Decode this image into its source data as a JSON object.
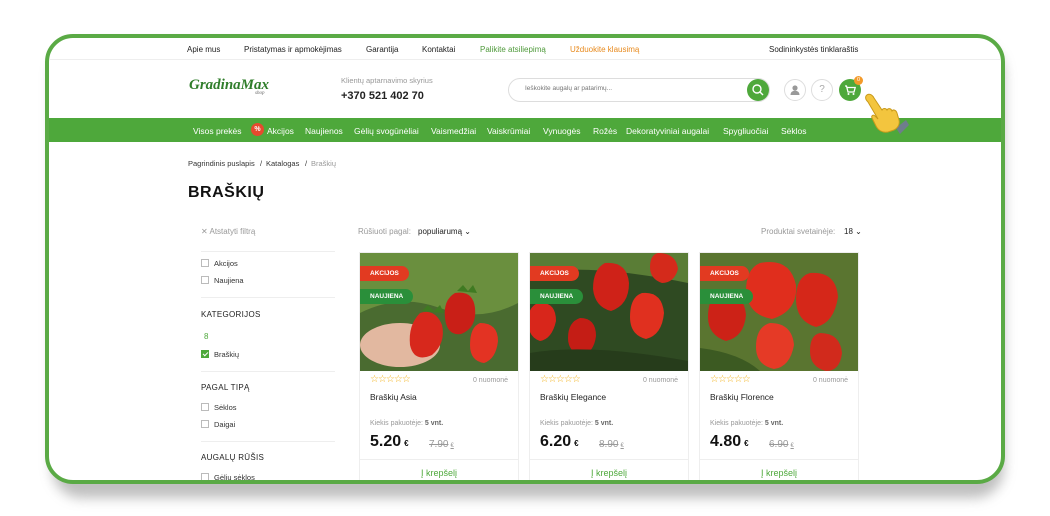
{
  "topbar": {
    "links": [
      "Apie mus",
      "Pristatymas ir apmokėjimas",
      "Garantija",
      "Kontaktai",
      "Palikite atsiliepimą",
      "Užduokite klausimą"
    ],
    "right_link": "Sodininkystės tinklaraštis"
  },
  "header": {
    "logo": "GradinaMax",
    "logo_sub": "shop",
    "cs_label": "Klientų aptarnavimo skyrius",
    "phone": "+370 521 402 70",
    "search_placeholder": "Ieškokite augalų ar patarimų...",
    "cart_count": "0"
  },
  "nav": {
    "items": [
      "Visos prekės",
      "Akcijos",
      "Naujienos",
      "Gėlių svogūnėliai",
      "Vaismedžiai",
      "Vaiskrūmiai",
      "Vynuogės",
      "Rožės",
      "Dekoratyviniai augalai",
      "Spygliuočiai",
      "Sėklos"
    ],
    "promo_symbol": "%"
  },
  "breadcrumb": [
    "Pagrindinis puslapis",
    "Katalogas",
    "Braškių"
  ],
  "page_title": "BRAŠKIŲ",
  "sidebar": {
    "reset": "Atstatyti filtrą",
    "flags": [
      "Akcijos",
      "Naujiena"
    ],
    "categories_title": "KATEGORIJOS",
    "category_count": "8",
    "category_checked": "Braškių",
    "type_title": "PAGAL TIPĄ",
    "types": [
      "Sėklos",
      "Daigai"
    ],
    "plant_title": "AUGALŲ RŪŠIS",
    "plants": [
      "Gėlių sėklos"
    ]
  },
  "toolbar": {
    "sort_label": "Rūšiuoti pagal:",
    "sort_value": "populiarumą",
    "per_page_label": "Produktai svetainėje:",
    "per_page_value": "18"
  },
  "products": [
    {
      "name": "Braškių Asia",
      "reviews": "0 nuomonė",
      "package": "Kiekis pakuotėje:",
      "package_value": "5 vnt.",
      "price": "5.20",
      "old_price": "7.90",
      "currency": "€",
      "sale_tag": "AKCIJOS",
      "new_tag": "NAUJIENA",
      "cart": "Į krepšelį"
    },
    {
      "name": "Braškių Elegance",
      "reviews": "0 nuomonė",
      "package": "Kiekis pakuotėje:",
      "package_value": "5 vnt.",
      "price": "6.20",
      "old_price": "8.90",
      "currency": "€",
      "sale_tag": "AKCIJOS",
      "new_tag": "NAUJIENA",
      "cart": "Į krepšelį"
    },
    {
      "name": "Braškių Florence",
      "reviews": "0 nuomonė",
      "package": "Kiekis pakuotėje:",
      "package_value": "5 vnt.",
      "price": "4.80",
      "old_price": "6.90",
      "currency": "€",
      "sale_tag": "AKCIJOS",
      "new_tag": "NAUJIENA",
      "cart": "Į krepšelį"
    }
  ],
  "colors": {
    "brand_green": "#4ea83b",
    "sale_red": "#e23a21",
    "new_green": "#2a8f3a",
    "accent_orange": "#e88a1d"
  }
}
